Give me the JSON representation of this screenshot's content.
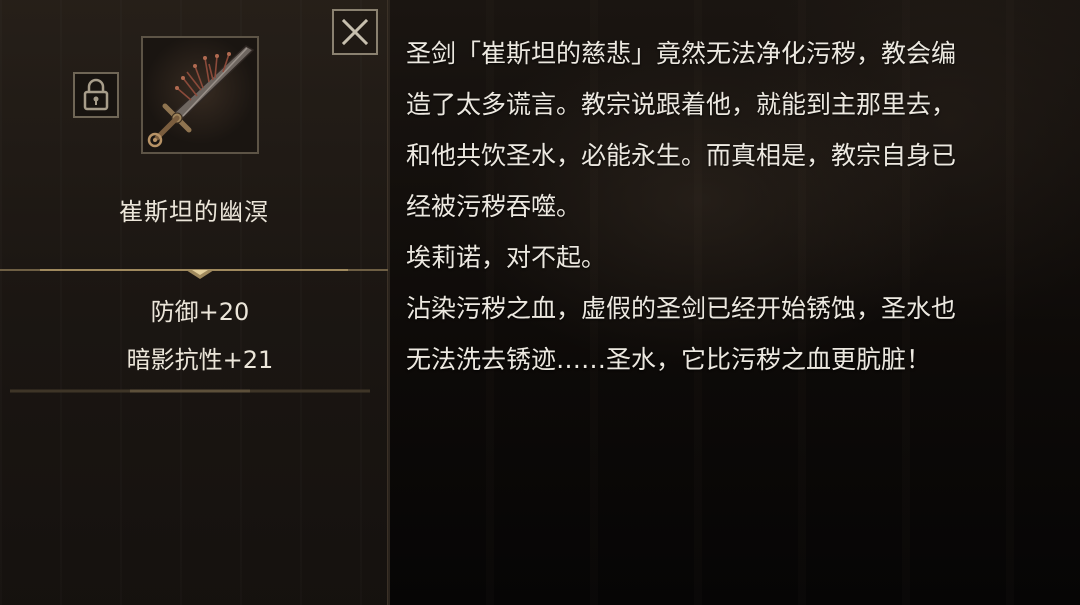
{
  "item": {
    "name": "崔斯坦的幽溟",
    "stats": [
      "防御+20",
      "暗影抗性+21"
    ]
  },
  "lore": {
    "lines": [
      "圣剑「崔斯坦的慈悲」竟然无法净化污秽，教会编",
      "造了太多谎言。教宗说跟着他，就能到主那里去，",
      "和他共饮圣水，必能永生。而真相是，教宗自身已",
      "经被污秽吞噬。",
      "埃莉诺，对不起。",
      "沾染污秽之血，虚假的圣剑已经开始锈蚀，圣水也",
      "无法洗去锈迹……圣水，它比污秽之血更肮脏！"
    ]
  },
  "icons": {
    "close": "close-icon",
    "lock": "lock-icon",
    "item": "rusted-sword-icon"
  },
  "colors": {
    "text": "#ece6da",
    "frame_border": "#5d5446",
    "divider_gold": "#8a7550",
    "panel_bg": "#1c1713"
  }
}
